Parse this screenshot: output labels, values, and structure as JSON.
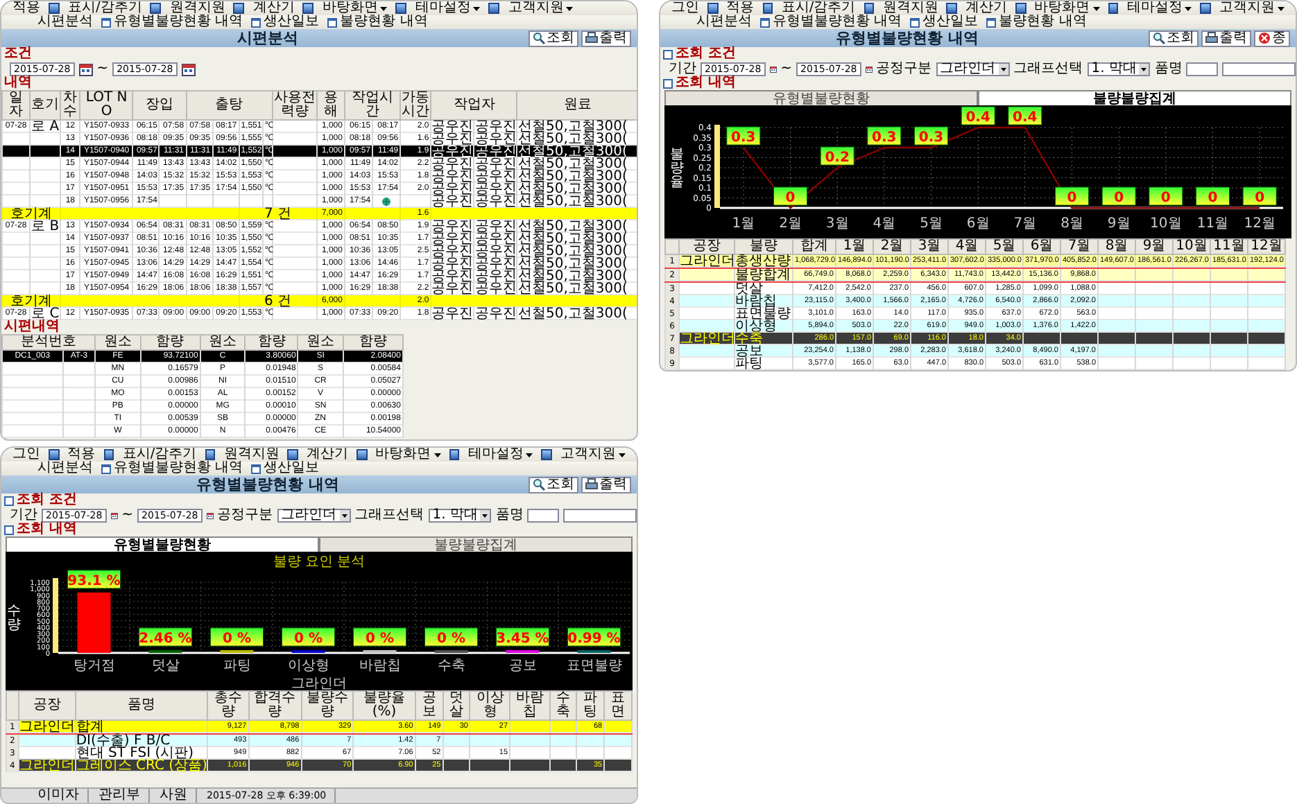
{
  "windows": [
    {
      "kind": "inspection",
      "menu": [
        {
          "label": "적용",
          "dropdown": false
        },
        {
          "label": "표시/감추기",
          "dropdown": false
        },
        {
          "label": "원격지원",
          "dropdown": false
        },
        {
          "label": "계산기",
          "dropdown": false
        },
        {
          "label": "바탕화면",
          "dropdown": true
        },
        {
          "label": "테마설정",
          "dropdown": true
        },
        {
          "label": "고객지원",
          "dropdown": true
        }
      ],
      "tabs": [
        "시편분석",
        "유형별불량현황 내역",
        "생산일보",
        "불량현황 내역"
      ],
      "title": "시편분석",
      "buttons": [
        {
          "kind": "search",
          "label": "조회"
        },
        {
          "kind": "print",
          "label": "출력"
        }
      ],
      "condition_label": "조건",
      "date_from": "2015-07-28",
      "range_separator": "~",
      "date_to": "2015-07-28",
      "list_label": "내역",
      "table": {
        "columns": [
          "일자",
          "호기",
          "차수",
          "LOT NO",
          "장입",
          "출탕",
          "사용전력량",
          "용해",
          "작업시간",
          "가동시간",
          "작업자",
          "원료"
        ],
        "groups": [
          {
            "date": "07-28",
            "furnace": "로 A",
            "rows": [
              {
                "seq": "12",
                "lot": "Y1507-0933",
                "charge_start": "06:15",
                "charge_end": "07:58",
                "tap_start": "07:58",
                "tap_end": "08:17",
                "temperature": "1,551",
                "unit": "℃",
                "melt": "1,000",
                "work_start": "06:15",
                "work_end": "08:17",
                "hours": "2.0",
                "worker_1": "공우진",
                "worker_2": "공우진",
                "material": "선철50,고철300(",
                "selected": false,
                "in_progress": false
              },
              {
                "seq": "13",
                "lot": "Y1507-0936",
                "charge_start": "08:18",
                "charge_end": "09:35",
                "tap_start": "09:35",
                "tap_end": "09:56",
                "temperature": "1,555",
                "unit": "℃",
                "melt": "1,000",
                "work_start": "08:18",
                "work_end": "09:56",
                "hours": "1.6",
                "worker_1": "공우진",
                "worker_2": "공우진",
                "material": "선철50,고철300(",
                "selected": false,
                "in_progress": false
              },
              {
                "seq": "14",
                "lot": "Y1507-0940",
                "charge_start": "09:57",
                "charge_end": "11:31",
                "tap_start": "11:31",
                "tap_end": "11:49",
                "temperature": "1,552",
                "unit": "℃",
                "melt": "1,000",
                "work_start": "09:57",
                "work_end": "11:49",
                "hours": "1.9",
                "worker_1": "공우진",
                "worker_2": "공우진",
                "material": "선철50,고철300(",
                "selected": true,
                "in_progress": false
              },
              {
                "seq": "15",
                "lot": "Y1507-0944",
                "charge_start": "11:49",
                "charge_end": "13:43",
                "tap_start": "13:43",
                "tap_end": "14:02",
                "temperature": "1,550",
                "unit": "℃",
                "melt": "1,000",
                "work_start": "11:49",
                "work_end": "14:02",
                "hours": "2.2",
                "worker_1": "공우진",
                "worker_2": "공우진",
                "material": "선철50,고철300(",
                "selected": false,
                "in_progress": false
              },
              {
                "seq": "16",
                "lot": "Y1507-0948",
                "charge_start": "14:03",
                "charge_end": "15:32",
                "tap_start": "15:32",
                "tap_end": "15:53",
                "temperature": "1,553",
                "unit": "℃",
                "melt": "1,000",
                "work_start": "14:03",
                "work_end": "15:53",
                "hours": "1.8",
                "worker_1": "공우진",
                "worker_2": "공우진",
                "material": "선철50,고철300(",
                "selected": false,
                "in_progress": false
              },
              {
                "seq": "17",
                "lot": "Y1507-0951",
                "charge_start": "15:53",
                "charge_end": "17:35",
                "tap_start": "17:35",
                "tap_end": "17:54",
                "temperature": "1,550",
                "unit": "℃",
                "melt": "1,000",
                "work_start": "15:53",
                "work_end": "17:54",
                "hours": "2.0",
                "worker_1": "공우진",
                "worker_2": "공우진",
                "material": "선철50,고철300(",
                "selected": false,
                "in_progress": false
              },
              {
                "seq": "18",
                "lot": "Y1507-0956",
                "charge_start": "17:54",
                "melt": "1,000",
                "work_start": "17:54",
                "worker_1": "공우진",
                "worker_2": "공우진",
                "material": "선철50,고철300(",
                "selected": false,
                "in_progress": true
              }
            ],
            "subtotal": {
              "label": "호기계",
              "count": "7 건",
              "melt": "7,000",
              "hours": "1.6"
            }
          },
          {
            "date": "07-28",
            "furnace": "로 B",
            "rows": [
              {
                "seq": "13",
                "lot": "Y1507-0934",
                "charge_start": "06:54",
                "charge_end": "08:31",
                "tap_start": "08:31",
                "tap_end": "08:50",
                "temperature": "1,559",
                "unit": "℃",
                "melt": "1,000",
                "work_start": "06:54",
                "work_end": "08:50",
                "hours": "1.9",
                "worker_1": "공우진",
                "worker_2": "공우진",
                "material": "선철50,고철300(",
                "selected": false,
                "in_progress": false
              },
              {
                "seq": "14",
                "lot": "Y1507-0937",
                "charge_start": "08:51",
                "charge_end": "10:16",
                "tap_start": "10:16",
                "tap_end": "10:35",
                "temperature": "1,550",
                "unit": "℃",
                "melt": "1,000",
                "work_start": "08:51",
                "work_end": "10:35",
                "hours": "1.7",
                "worker_1": "공우진",
                "worker_2": "공우진",
                "material": "선철50,고철300(",
                "selected": false,
                "in_progress": false
              },
              {
                "seq": "15",
                "lot": "Y1507-0941",
                "charge_start": "10:36",
                "charge_end": "12:48",
                "tap_start": "12:48",
                "tap_end": "13:05",
                "temperature": "1,552",
                "unit": "℃",
                "melt": "1,000",
                "work_start": "10:36",
                "work_end": "13:05",
                "hours": "2.5",
                "worker_1": "공우진",
                "worker_2": "공우진",
                "material": "선철50,고철300(",
                "selected": false,
                "in_progress": false
              },
              {
                "seq": "16",
                "lot": "Y1507-0945",
                "charge_start": "13:06",
                "charge_end": "14:29",
                "tap_start": "14:29",
                "tap_end": "14:47",
                "temperature": "1,554",
                "unit": "℃",
                "melt": "1,000",
                "work_start": "13:06",
                "work_end": "14:46",
                "hours": "1.7",
                "worker_1": "공우진",
                "worker_2": "공우진",
                "material": "선철50,고철300(",
                "selected": false,
                "in_progress": false
              },
              {
                "seq": "17",
                "lot": "Y1507-0949",
                "charge_start": "14:47",
                "charge_end": "16:08",
                "tap_start": "16:08",
                "tap_end": "16:29",
                "temperature": "1,551",
                "unit": "℃",
                "melt": "1,000",
                "work_start": "14:47",
                "work_end": "16:29",
                "hours": "1.7",
                "worker_1": "공우진",
                "worker_2": "공우진",
                "material": "선철50,고철300(",
                "selected": false,
                "in_progress": false
              },
              {
                "seq": "18",
                "lot": "Y1507-0954",
                "charge_start": "16:29",
                "charge_end": "18:06",
                "tap_start": "18:06",
                "tap_end": "18:38",
                "temperature": "1,557",
                "unit": "℃",
                "melt": "1,000",
                "work_start": "16:29",
                "work_end": "18:38",
                "hours": "2.2",
                "worker_1": "공우진",
                "worker_2": "공우진",
                "material": "선철50,고철300(",
                "selected": false,
                "in_progress": false
              }
            ],
            "subtotal": {
              "label": "호기계",
              "count": "6 건",
              "melt": "6,000",
              "hours": "2.0"
            }
          },
          {
            "date": "07-28",
            "furnace": "로 C",
            "rows": [
              {
                "seq": "12",
                "lot": "Y1507-0935",
                "charge_start": "07:33",
                "charge_end": "09:00",
                "tap_start": "09:00",
                "tap_end": "09:20",
                "temperature": "1,553",
                "unit": "℃",
                "melt": "1,000",
                "work_start": "07:33",
                "work_end": "09:20",
                "hours": "1.8",
                "worker_1": "공우진",
                "worker_2": "공우진",
                "material": "선철50,고철300(",
                "selected": false,
                "in_progress": false
              }
            ]
          }
        ]
      },
      "detail_label": "시편내역",
      "detail_table": {
        "columns": [
          "분석번호",
          "원소",
          "함량",
          "원소",
          "함량",
          "원소",
          "함량"
        ],
        "rows": [
          {
            "sample_id": "DC1_003",
            "grade": "AT-3",
            "elements": [
              {
                "name": "FE",
                "value": "93.72100"
              },
              {
                "name": "C",
                "value": "3.80060"
              },
              {
                "name": "SI",
                "value": "2.08400"
              }
            ],
            "selected": true
          },
          {
            "elements": [
              {
                "name": "MN",
                "value": "0.16579"
              },
              {
                "name": "P",
                "value": "0.01948"
              },
              {
                "name": "S",
                "value": "0.00584"
              }
            ],
            "selected": false
          },
          {
            "elements": [
              {
                "name": "CU",
                "value": "0.00986"
              },
              {
                "name": "NI",
                "value": "0.01510"
              },
              {
                "name": "CR",
                "value": "0.05027"
              }
            ],
            "selected": false
          },
          {
            "elements": [
              {
                "name": "MO",
                "value": "0.00153"
              },
              {
                "name": "AL",
                "value": "0.00152"
              },
              {
                "name": "V",
                "value": "0.00000"
              }
            ],
            "selected": false
          },
          {
            "elements": [
              {
                "name": "PB",
                "value": "0.00000"
              },
              {
                "name": "MG",
                "value": "0.00010"
              },
              {
                "name": "SN",
                "value": "0.00630"
              }
            ],
            "selected": false
          },
          {
            "elements": [
              {
                "name": "TI",
                "value": "0.00539"
              },
              {
                "name": "SB",
                "value": "0.00000"
              },
              {
                "name": "ZN",
                "value": "0.00198"
              }
            ],
            "selected": false
          },
          {
            "elements": [
              {
                "name": "W",
                "value": "0.00000"
              },
              {
                "name": "N",
                "value": "0.00476"
              },
              {
                "name": "CE",
                "value": "10.54000"
              }
            ],
            "selected": false
          }
        ]
      }
    },
    {
      "kind": "report",
      "menu": [
        {
          "label": "그인",
          "dropdown": false
        },
        {
          "label": "적용",
          "dropdown": false
        },
        {
          "label": "표시/감추기",
          "dropdown": false
        },
        {
          "label": "원격지원",
          "dropdown": false
        },
        {
          "label": "계산기",
          "dropdown": false
        },
        {
          "label": "바탕화면",
          "dropdown": true
        },
        {
          "label": "테마설정",
          "dropdown": true
        },
        {
          "label": "고객지원",
          "dropdown": true
        }
      ],
      "tabs": [
        "시편분석",
        "유형별불량현황 내역",
        "생산일보",
        "불량현황 내역"
      ],
      "title": "유형별불량현황 내역",
      "buttons": [
        {
          "kind": "search",
          "label": "조회"
        },
        {
          "kind": "print",
          "label": "출력"
        },
        {
          "kind": "close",
          "label": "종"
        }
      ],
      "condition_label": "조회 조건",
      "conditions": {
        "period_label": "기간",
        "date_from": "2015-07-28",
        "range_separator": "~",
        "date_to": "2015-07-28",
        "process_label": "공정구분",
        "process": "그라인더",
        "graph_label": "그래프선택",
        "graph": "1. 막대",
        "product_label": "품명"
      },
      "list_label": "조회 내역",
      "view_tabs": [
        {
          "label": "유형별불량현황",
          "selected": false
        },
        {
          "label": "불량불량집계",
          "selected": true
        }
      ],
      "chart_data": {
        "type": "line",
        "ylabel": "불량율",
        "categories": [
          "1월",
          "2월",
          "3월",
          "4월",
          "5월",
          "6월",
          "7월",
          "8월",
          "9월",
          "10월",
          "11월",
          "12월"
        ],
        "series": [
          {
            "color": "#8b0000",
            "values": [
              0.3,
              0,
              0.2,
              0.3,
              0.3,
              0.4,
              0.4,
              0,
              0,
              0,
              0,
              0
            ]
          }
        ],
        "ylim": [
          0,
          0.4
        ],
        "yticks": [
          0,
          0.05,
          0.1,
          0.15,
          0.2,
          0.25,
          0.3,
          0.35,
          0.4
        ],
        "grid": true,
        "data_labels": true
      },
      "table": {
        "columns": [
          "공장",
          "불량",
          "합계",
          "1월",
          "2월",
          "3월",
          "4월",
          "5월",
          "6월",
          "7월",
          "8월",
          "9월",
          "10월",
          "11월",
          "12월"
        ],
        "rows": [
          {
            "no": "1",
            "plant": "그라인더",
            "item": "총생산량",
            "kind": "production",
            "selected": false,
            "values": {
              "total": "1,068,729.0",
              "m1": "146,894.0",
              "m2": "101,190.0",
              "m3": "253,411.0",
              "m4": "307,602.0",
              "m5": "335,000.0",
              "m6": "371,970.0",
              "m7": "405,852.0",
              "m8": "149,607.0",
              "m9": "186,561.0",
              "m10": "226,267.0",
              "m11": "185,631.0",
              "m12": "192,124.0"
            }
          },
          {
            "no": "2",
            "item": "불량합계",
            "kind": "defect_sum",
            "selected": false,
            "values": {
              "total": "66,749.0",
              "m1": "8,068.0",
              "m2": "2,259.0",
              "m3": "6,343.0",
              "m4": "11,743.0",
              "m5": "13,442.0",
              "m6": "15,136.0",
              "m7": "9,868.0"
            }
          },
          {
            "no": "3",
            "item": "덧살",
            "kind": "item",
            "selected": false,
            "values": {
              "total": "7,412.0",
              "m1": "2,542.0",
              "m2": "237.0",
              "m3": "456.0",
              "m4": "607.0",
              "m5": "1,285.0",
              "m6": "1,099.0",
              "m7": "1,088.0"
            }
          },
          {
            "no": "4",
            "item": "바람칩",
            "kind": "item",
            "selected": false,
            "values": {
              "total": "23,115.0",
              "m1": "3,400.0",
              "m2": "1,566.0",
              "m3": "2,165.0",
              "m4": "4,726.0",
              "m5": "6,540.0",
              "m6": "2,866.0",
              "m7": "2,092.0"
            }
          },
          {
            "no": "5",
            "item": "표면불량",
            "kind": "item",
            "selected": false,
            "values": {
              "total": "3,101.0",
              "m1": "163.0",
              "m2": "14.0",
              "m3": "117.0",
              "m4": "935.0",
              "m5": "637.0",
              "m6": "672.0",
              "m7": "563.0"
            }
          },
          {
            "no": "6",
            "item": "이상형",
            "kind": "item",
            "selected": false,
            "values": {
              "total": "5,894.0",
              "m1": "503.0",
              "m2": "22.0",
              "m3": "619.0",
              "m4": "949.0",
              "m5": "1,003.0",
              "m6": "1,376.0",
              "m7": "1,422.0"
            }
          },
          {
            "no": "7",
            "plant": "그라인더",
            "item": "수축",
            "kind": "item",
            "selected": true,
            "values": {
              "total": "286.0",
              "m1": "157.0",
              "m2": "69.0",
              "m3": "116.0",
              "m4": "18.0",
              "m5": "34.0"
            }
          },
          {
            "no": "8",
            "item": "공보",
            "kind": "item",
            "selected": false,
            "values": {
              "total": "23,254.0",
              "m1": "1,138.0",
              "m2": "298.0",
              "m3": "2,283.0",
              "m4": "3,618.0",
              "m5": "3,240.0",
              "m6": "8,490.0",
              "m7": "4,197.0"
            }
          },
          {
            "no": "9",
            "item": "파팅",
            "kind": "item",
            "selected": false,
            "values": {
              "total": "3,577.0",
              "m1": "165.0",
              "m2": "63.0",
              "m3": "447.0",
              "m4": "830.0",
              "m5": "503.0",
              "m6": "631.0",
              "m7": "538.0"
            }
          }
        ]
      }
    },
    {
      "kind": "report",
      "menu": [
        {
          "label": "그인",
          "dropdown": false
        },
        {
          "label": "적용",
          "dropdown": false
        },
        {
          "label": "표시/감추기",
          "dropdown": false
        },
        {
          "label": "원격지원",
          "dropdown": false
        },
        {
          "label": "계산기",
          "dropdown": false
        },
        {
          "label": "바탕화면",
          "dropdown": true
        },
        {
          "label": "테마설정",
          "dropdown": true
        },
        {
          "label": "고객지원",
          "dropdown": true
        }
      ],
      "tabs": [
        "시편분석",
        "유형별불량현황 내역",
        "생산일보"
      ],
      "title": "유형별불량현황 내역",
      "buttons": [
        {
          "kind": "search",
          "label": "조회"
        },
        {
          "kind": "print",
          "label": "출력"
        }
      ],
      "condition_label": "조회 조건",
      "conditions": {
        "period_label": "기간",
        "date_from": "2015-07-28",
        "range_separator": "~",
        "date_to": "2015-07-28",
        "process_label": "공정구분",
        "process": "그라인더",
        "graph_label": "그래프선택",
        "graph": "1. 막대",
        "product_label": "품명"
      },
      "list_label": "조회 내역",
      "view_tabs": [
        {
          "label": "유형별불량현황",
          "selected": true
        },
        {
          "label": "불량불량집계",
          "selected": false
        }
      ],
      "chart_data": {
        "type": "bar",
        "title": "불량 요인 분석",
        "xlabel": "그라인더",
        "ylabel": "수량",
        "categories": [
          "탕거점",
          "덧살",
          "파팅",
          "이상형",
          "바람칩",
          "수축",
          "공보",
          "표면불량"
        ],
        "series": [
          {
            "color": "#ff0000",
            "values": [
              940,
              null,
              null,
              null,
              null,
              null,
              null,
              null
            ]
          },
          {
            "color": "#006400",
            "values": [
              null,
              30,
              null,
              null,
              null,
              null,
              null,
              null
            ]
          },
          {
            "color": "#b8b800",
            "values": [
              null,
              null,
              0,
              null,
              null,
              null,
              null,
              null
            ]
          },
          {
            "color": "#0000cc",
            "values": [
              null,
              null,
              null,
              0,
              null,
              null,
              null,
              null
            ]
          },
          {
            "color": "#c0c0c0",
            "values": [
              null,
              null,
              null,
              null,
              0,
              null,
              null,
              null
            ]
          },
          {
            "color": "#505050",
            "values": [
              null,
              null,
              null,
              null,
              null,
              0,
              null,
              null
            ]
          },
          {
            "color": "#e000e0",
            "values": [
              null,
              null,
              null,
              null,
              null,
              null,
              40,
              null
            ]
          },
          {
            "color": "#006060",
            "values": [
              null,
              null,
              null,
              null,
              null,
              null,
              null,
              10
            ]
          }
        ],
        "ylim": [
          0,
          1100
        ],
        "yticks": [
          {
            "value": 0,
            "label": "0"
          },
          {
            "value": 100,
            "label": "100"
          },
          {
            "value": 200,
            "label": "200"
          },
          {
            "value": 300,
            "label": "300"
          },
          {
            "value": 400,
            "label": "400"
          },
          {
            "value": 500,
            "label": "500"
          },
          {
            "value": 600,
            "label": "600"
          },
          {
            "value": 700,
            "label": "700"
          },
          {
            "value": 800,
            "label": "800"
          },
          {
            "value": 900,
            "label": "900"
          },
          {
            "value": 1000,
            "label": "1,000"
          },
          {
            "value": 1100,
            "label": "1,100"
          }
        ],
        "grid": true,
        "value_labels": [
          "93.1 %",
          "2.46 %",
          "0 %",
          "0 %",
          "0 %",
          "0 %",
          "3.45 %",
          "0.99 %"
        ]
      },
      "table": {
        "columns": [
          "공장",
          "품명",
          "총수량",
          "합격수량",
          "불량수량",
          "불량율(%)",
          "공보",
          "덧살",
          "이상형",
          "바람칩",
          "수축",
          "파팅",
          "표면"
        ],
        "rows": [
          {
            "no": "1",
            "plant": "그라인더",
            "item": "합계",
            "kind": "total",
            "selected": false,
            "values": {
              "qty": "9,127",
              "pass": "8,798",
              "defect": "329",
              "rate": "3.60",
              "type_1": "149",
              "type_2": "30",
              "type_3": "27",
              "type_6": "68"
            }
          },
          {
            "no": "2",
            "item": "DI(수출) F B/C",
            "kind": "item",
            "selected": false,
            "values": {
              "qty": "493",
              "pass": "486",
              "defect": "7",
              "rate": "1.42",
              "type_1": "7"
            }
          },
          {
            "no": "3",
            "item": "현대 ST FSI (시판)",
            "kind": "item",
            "selected": false,
            "values": {
              "qty": "949",
              "pass": "882",
              "defect": "67",
              "rate": "7.06",
              "type_1": "52",
              "type_3": "15"
            }
          },
          {
            "no": "4",
            "plant": "그라인더",
            "item": "그레이스 CRC (상품)",
            "kind": "item",
            "selected": true,
            "values": {
              "qty": "1,016",
              "pass": "946",
              "defect": "70",
              "rate": "6.90",
              "type_1": "25",
              "type_6": "35"
            }
          }
        ]
      },
      "status_bar": [
        "이미자",
        "관리부",
        "사원",
        "2015-07-28 오후 6:39:00"
      ]
    }
  ]
}
